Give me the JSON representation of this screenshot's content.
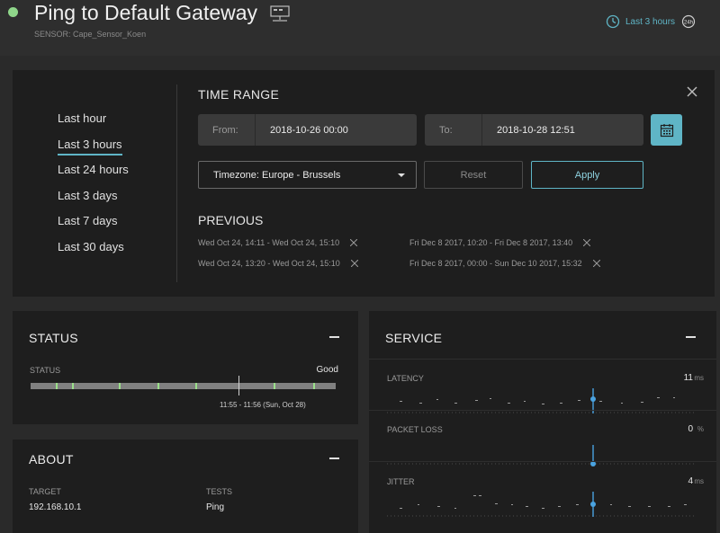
{
  "header": {
    "title": "Ping to Default Gateway",
    "sensor_label": "SENSOR:  Cape_Sensor_Koen",
    "range_indicator": "Last 3 hours",
    "h24_label": "24h",
    "status_color": "#8fd68a"
  },
  "time_range": {
    "quick_options": [
      "Last hour",
      "Last 3 hours",
      "Last 24 hours",
      "Last 3 days",
      "Last 7 days",
      "Last 30 days"
    ],
    "selected": "Last 3 hours",
    "title": "TIME RANGE",
    "from_label": "From:",
    "from_value": "2018-10-26 00:00",
    "to_label": "To:",
    "to_value": "2018-10-28 12:51",
    "timezone": "Timezone: Europe - Brussels",
    "reset_label": "Reset",
    "apply_label": "Apply",
    "previous_title": "PREVIOUS",
    "previous": [
      "Wed Oct 24, 14:11 - Wed Oct 24, 15:10",
      "Fri Dec 8 2017, 10:20 - Fri Dec 8 2017, 13:40",
      "Wed Oct 24, 13:20 - Wed Oct 24, 15:10",
      "Fri Dec 8 2017, 00:00 - Sun Dec 10 2017, 15:32"
    ]
  },
  "status": {
    "title": "STATUS",
    "label": "STATUS",
    "value": "Good",
    "hover_time": "11:55 - 11:56 (Sun, Oct 28)",
    "good_color": "#9be08a"
  },
  "about": {
    "title": "ABOUT",
    "target_label": "TARGET",
    "target_value": "192.168.10.1",
    "tests_label": "TESTS",
    "tests_value": "Ping"
  },
  "service": {
    "title": "SERVICE",
    "metrics": [
      {
        "name": "LATENCY",
        "value": "11",
        "unit": "ms"
      },
      {
        "name": "PACKET LOSS",
        "value": "0",
        "unit": "%"
      },
      {
        "name": "JITTER",
        "value": "4",
        "unit": "ms"
      }
    ]
  },
  "accent_color": "#5fb5c6"
}
